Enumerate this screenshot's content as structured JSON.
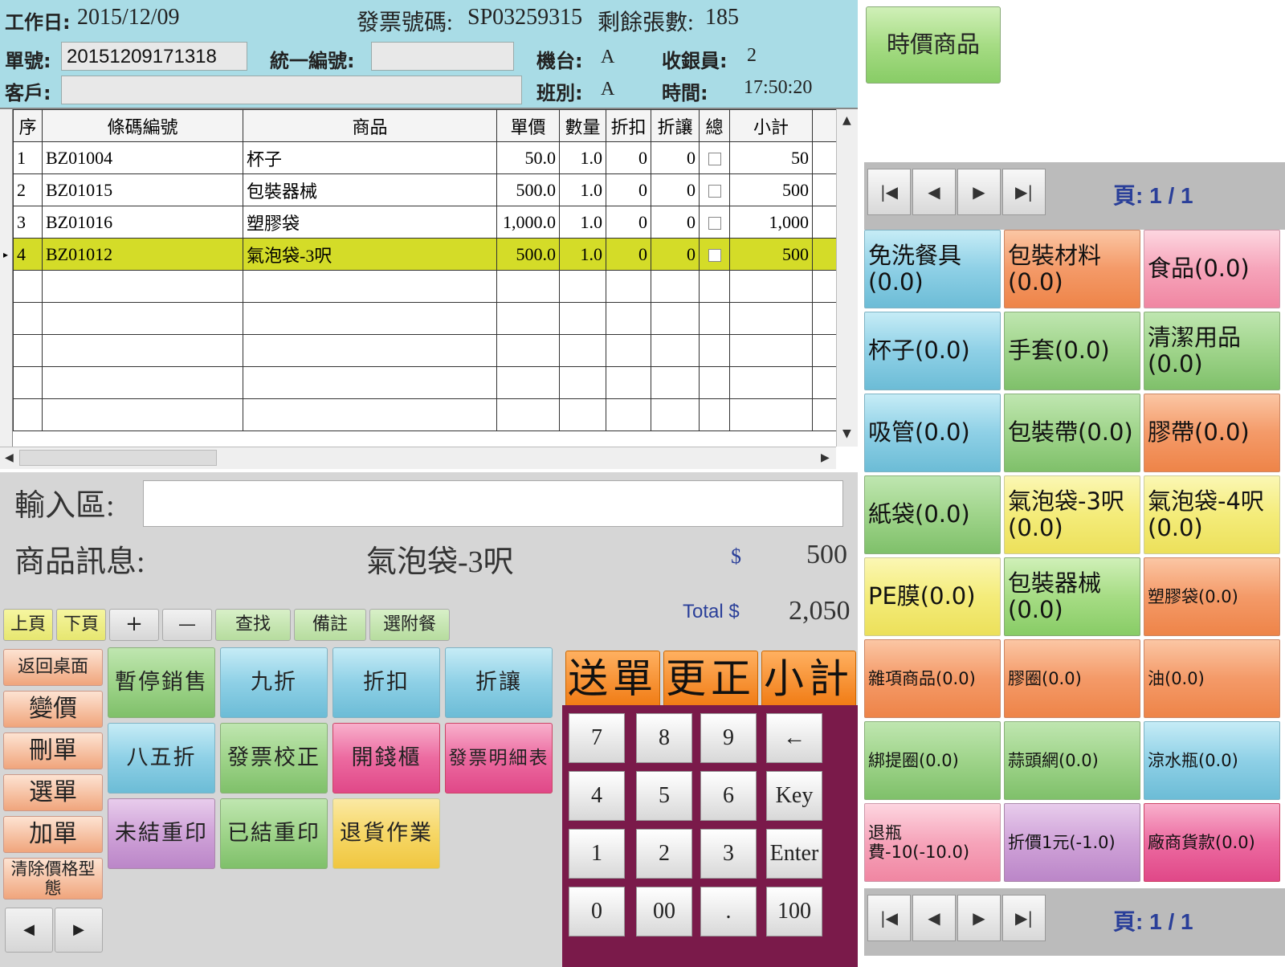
{
  "header": {
    "workday_label": "工作日:",
    "workday": "2015/12/09",
    "invoice_label": "發票號碼:",
    "invoice_no": "SP03259315",
    "remain_label": "剩餘張數:",
    "remain": "185",
    "order_label": "單號:",
    "order_no": "20151209171318",
    "tax_label": "統一編號:",
    "tax_value": "",
    "machine_label": "機台:",
    "machine": "A",
    "cashier_label": "收銀員:",
    "cashier": "2",
    "customer_label": "客戶:",
    "customer_value": "",
    "shift_label": "班別:",
    "shift": "A",
    "time_label": "時間:",
    "time": "17:50:20"
  },
  "grid": {
    "columns": [
      "序",
      "條碼編號",
      "商品",
      "單價",
      "數量",
      "折扣",
      "折讓",
      "總",
      "小計"
    ],
    "rows": [
      {
        "seq": "1",
        "code": "BZ01004",
        "name": "杯子",
        "price": "50.0",
        "qty": "1.0",
        "disc": "0",
        "allow": "0",
        "sub": "50"
      },
      {
        "seq": "2",
        "code": "BZ01015",
        "name": "包裝器械",
        "price": "500.0",
        "qty": "1.0",
        "disc": "0",
        "allow": "0",
        "sub": "500"
      },
      {
        "seq": "3",
        "code": "BZ01016",
        "name": "塑膠袋",
        "price": "1,000.0",
        "qty": "1.0",
        "disc": "0",
        "allow": "0",
        "sub": "1,000"
      },
      {
        "seq": "4",
        "code": "BZ01012",
        "name": "氣泡袋-3呎",
        "price": "500.0",
        "qty": "1.0",
        "disc": "0",
        "allow": "0",
        "sub": "500"
      }
    ],
    "selected_row": 4
  },
  "input": {
    "label": "輸入區:",
    "value": ""
  },
  "product_info": {
    "label": "商品訊息:",
    "name": "氣泡袋-3呎",
    "currency": "$",
    "price": "500",
    "total_label": "Total $",
    "total": "2,050"
  },
  "toolbar": [
    "上頁",
    "下頁",
    "+",
    "—",
    "查找",
    "備註",
    "選附餐"
  ],
  "side_buttons": [
    "返回桌面",
    "變價",
    "刪單",
    "選單",
    "加單",
    "清除價格型態"
  ],
  "action_buttons": [
    {
      "label": "暫停銷售",
      "color": "g"
    },
    {
      "label": "九折",
      "color": "b"
    },
    {
      "label": "折扣",
      "color": "b"
    },
    {
      "label": "折讓",
      "color": "b"
    },
    {
      "label": "八五折",
      "color": "b"
    },
    {
      "label": "發票校正",
      "color": "g"
    },
    {
      "label": "開錢櫃",
      "color": "p"
    },
    {
      "label": "發票明細表",
      "color": "p"
    },
    {
      "label": "未結重印",
      "color": "pu"
    },
    {
      "label": "已結重印",
      "color": "g"
    },
    {
      "label": "退貨作業",
      "color": "y"
    }
  ],
  "big_buttons": [
    "送單",
    "更正",
    "小計"
  ],
  "numpad": [
    "7",
    "8",
    "9",
    "←",
    "4",
    "5",
    "6",
    "Key",
    "1",
    "2",
    "3",
    "Enter",
    "0",
    "00",
    ".",
    "100"
  ],
  "right": {
    "top_button": "時價商品",
    "page_label": "頁: 1 / 1",
    "categories": [
      {
        "label": "免洗餐具(0.0)",
        "color": "b"
      },
      {
        "label": "包裝材料(0.0)",
        "color": "o"
      },
      {
        "label": "食品(0.0)",
        "color": "lp"
      },
      {
        "label": "杯子(0.0)",
        "color": "b"
      },
      {
        "label": "手套(0.0)",
        "color": "g"
      },
      {
        "label": "清潔用品(0.0)",
        "color": "g"
      },
      {
        "label": "吸管(0.0)",
        "color": "b"
      },
      {
        "label": "包裝帶(0.0)",
        "color": "g"
      },
      {
        "label": "膠帶(0.0)",
        "color": "o"
      },
      {
        "label": "紙袋(0.0)",
        "color": "g"
      },
      {
        "label": "氣泡袋-3呎(0.0)",
        "color": "ly"
      },
      {
        "label": "氣泡袋-4呎(0.0)",
        "color": "ly"
      },
      {
        "label": "PE膜(0.0)",
        "color": "ly"
      },
      {
        "label": "包裝器械(0.0)",
        "color": "lg"
      },
      {
        "label": "塑膠袋(0.0)",
        "color": "o"
      },
      {
        "label": "雜項商品(0.0)",
        "color": "o"
      },
      {
        "label": "膠圈(0.0)",
        "color": "o"
      },
      {
        "label": "油(0.0)",
        "color": "o"
      },
      {
        "label": "綁提圈(0.0)",
        "color": "g"
      },
      {
        "label": "蒜頭網(0.0)",
        "color": "g"
      },
      {
        "label": "涼水瓶(0.0)",
        "color": "b"
      },
      {
        "label": "退瓶費-10(-10.0)",
        "color": "lp"
      },
      {
        "label": "折價1元(-1.0)",
        "color": "pu"
      },
      {
        "label": "廠商貨款(0.0)",
        "color": "p"
      }
    ]
  }
}
